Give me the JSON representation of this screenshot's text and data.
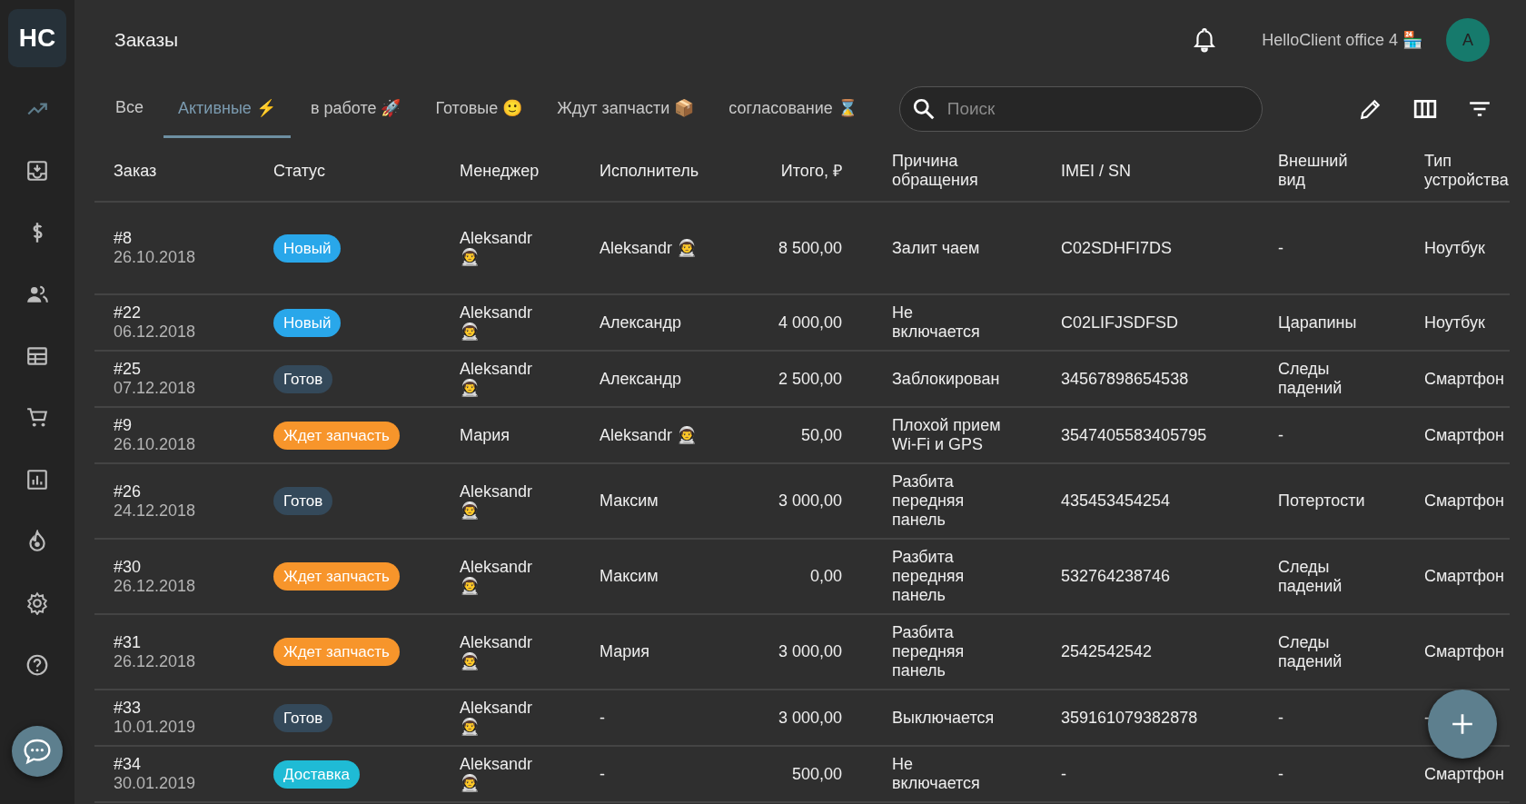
{
  "logo": "HC",
  "header": {
    "title": "Заказы",
    "office": "HelloClient office 4 🏪",
    "avatar": "A"
  },
  "tabs": [
    {
      "label": "Все",
      "selected": false
    },
    {
      "label": "Активные ⚡",
      "selected": true
    },
    {
      "label": "в работе 🚀",
      "selected": false
    },
    {
      "label": "Готовые 🙂",
      "selected": false
    },
    {
      "label": "Ждут запчасти 📦",
      "selected": false
    },
    {
      "label": "согласование ⌛",
      "selected": false
    }
  ],
  "search": {
    "placeholder": "Поиск"
  },
  "table": {
    "columns": [
      "Заказ",
      "Статус",
      "Менеджер",
      "Исполнитель",
      "Итого, ₽",
      "Причина\nобращения",
      "IMEI / SN",
      "Внешний\nвид",
      "Тип\nустройства"
    ],
    "rows": [
      {
        "order": "#8",
        "date": "26.10.2018",
        "status": {
          "label": "Новый",
          "color": "#29a7ea"
        },
        "manager": "Aleksandr 👨‍🚀",
        "executor": "Aleksandr 👨‍🚀",
        "total": "8 500,00",
        "reason": "Залит чаем",
        "imei": "C02SDHFI7DS",
        "appearance": "-",
        "device_type": "Ноутбук"
      },
      {
        "order": "#22",
        "date": "06.12.2018",
        "status": {
          "label": "Новый",
          "color": "#29a7ea"
        },
        "manager": "Aleksandr 👨‍🚀",
        "executor": "Александр",
        "total": "4 000,00",
        "reason": "Не\nвключается",
        "imei": "C02LIFJSDFSD",
        "appearance": "Царапины",
        "device_type": "Ноутбук"
      },
      {
        "order": "#25",
        "date": "07.12.2018",
        "status": {
          "label": "Готов",
          "color": "#34495a"
        },
        "manager": "Aleksandr 👨‍🚀",
        "executor": "Александр",
        "total": "2 500,00",
        "reason": "Заблокирован",
        "imei": "34567898654538",
        "appearance": "Следы\nпадений",
        "device_type": "Смартфон"
      },
      {
        "order": "#9",
        "date": "26.10.2018",
        "status": {
          "label": "Ждет запчасть",
          "color": "#f7952b"
        },
        "manager": "Мария",
        "executor": "Aleksandr 👨‍🚀",
        "total": "50,00",
        "reason": "Плохой прием\nWi-Fi и GPS",
        "imei": "3547405583405795",
        "appearance": "-",
        "device_type": "Смартфон"
      },
      {
        "order": "#26",
        "date": "24.12.2018",
        "status": {
          "label": "Готов",
          "color": "#34495a"
        },
        "manager": "Aleksandr 👨‍🚀",
        "executor": "Максим",
        "total": "3 000,00",
        "reason": "Разбита\nпередняя\nпанель",
        "imei": "435453454254",
        "appearance": "Потертости",
        "device_type": "Смартфон"
      },
      {
        "order": "#30",
        "date": "26.12.2018",
        "status": {
          "label": "Ждет запчасть",
          "color": "#f7952b"
        },
        "manager": "Aleksandr 👨‍🚀",
        "executor": "Максим",
        "total": "0,00",
        "reason": "Разбита\nпередняя\nпанель",
        "imei": "532764238746",
        "appearance": "Следы\nпадений",
        "device_type": "Смартфон"
      },
      {
        "order": "#31",
        "date": "26.12.2018",
        "status": {
          "label": "Ждет запчасть",
          "color": "#f7952b"
        },
        "manager": "Aleksandr 👨‍🚀",
        "executor": "Мария",
        "total": "3 000,00",
        "reason": "Разбита\nпередняя\nпанель",
        "imei": "2542542542",
        "appearance": "Следы\nпадений",
        "device_type": "Смартфон"
      },
      {
        "order": "#33",
        "date": "10.01.2019",
        "status": {
          "label": "Готов",
          "color": "#34495a"
        },
        "manager": "Aleksandr 👨‍🚀",
        "executor": "-",
        "total": "3 000,00",
        "reason": "Выключается",
        "imei": "359161079382878",
        "appearance": "-",
        "device_type": "-"
      },
      {
        "order": "#34",
        "date": "30.01.2019",
        "status": {
          "label": "Доставка",
          "color": "#1fbbd5"
        },
        "manager": "Aleksandr 👨‍🚀",
        "executor": "-",
        "total": "500,00",
        "reason": "Не\nвключается",
        "imei": "-",
        "appearance": "-",
        "device_type": "Смартфон"
      }
    ]
  }
}
